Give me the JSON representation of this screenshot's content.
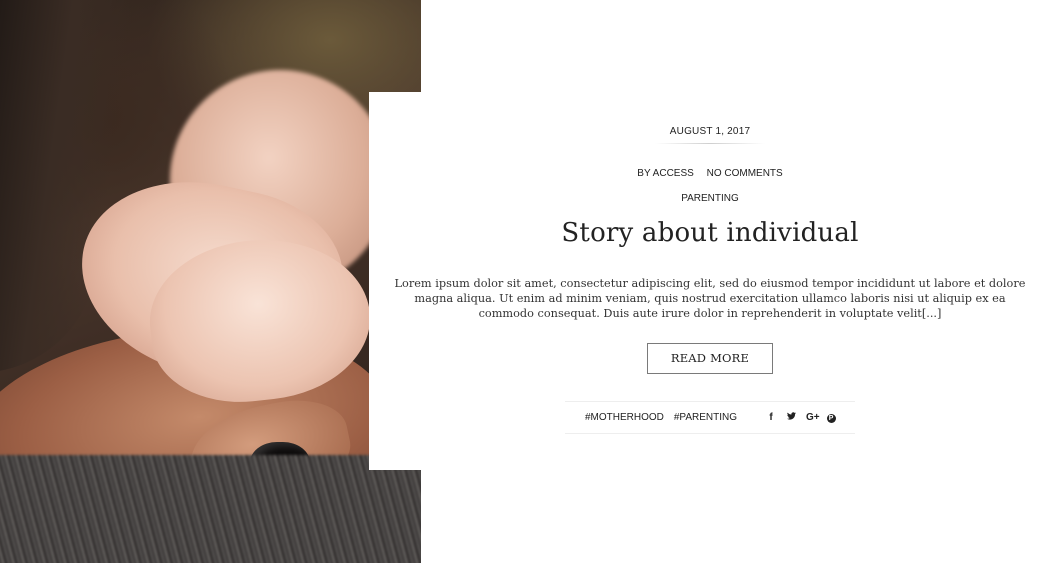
{
  "post": {
    "date": "AUGUST 1, 2017",
    "author": "BY ACCESS",
    "comments": "NO COMMENTS",
    "category": "PARENTING",
    "title": "Story about individual",
    "excerpt": "Lorem ipsum dolor sit amet, consectetur adipiscing elit, sed do eiusmod tempor incididunt ut labore et dolore magna aliqua. Ut enim ad minim veniam, quis nostrud exercitation ullamco laboris nisi ut aliquip ex ea commodo consequat. Duis aute irure dolor in reprehenderit in voluptate velit[...]",
    "read_more_label": "READ MORE",
    "tags": [
      "#MOTHERHOOD",
      "#PARENTING"
    ]
  },
  "share": {
    "icons": [
      {
        "name": "facebook-icon",
        "glyph": "f"
      },
      {
        "name": "twitter-icon",
        "glyph": "🐦"
      },
      {
        "name": "google-plus-icon",
        "glyph": "G+"
      },
      {
        "name": "pinterest-icon",
        "glyph": "P"
      }
    ]
  }
}
